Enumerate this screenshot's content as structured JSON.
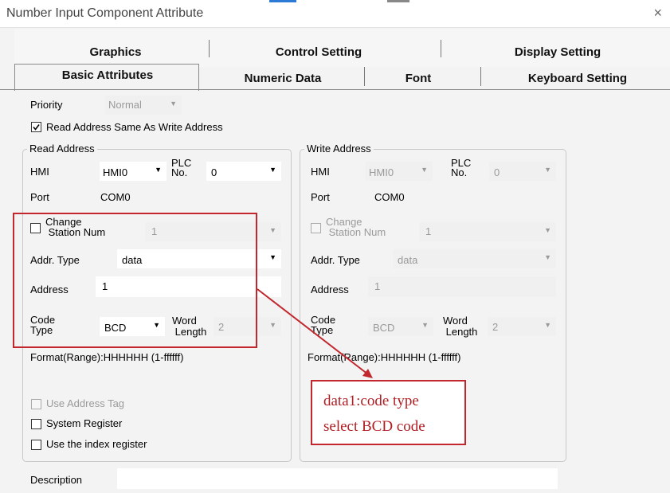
{
  "window": {
    "title": "Number Input Component Attribute",
    "close": "×"
  },
  "tabs": {
    "row1": [
      "Graphics",
      "Control Setting",
      "Display Setting"
    ],
    "row2": [
      "Basic Attributes",
      "Numeric Data",
      "Font",
      "Keyboard Setting"
    ]
  },
  "priority": {
    "label": "Priority",
    "value": "Normal"
  },
  "same_address": {
    "label": "Read Address Same As Write Address",
    "checked": true
  },
  "read": {
    "legend": "Read Address",
    "hmi_label": "HMI",
    "hmi_value": "HMI0",
    "plc_label_1": "PLC",
    "plc_label_2": "No.",
    "plc_value": "0",
    "port_label": "Port",
    "port_value": "COM0",
    "change_label_1": "Change",
    "change_label_2": "Station Num",
    "station_value": "1",
    "addr_type_label": "Addr. Type",
    "addr_type_value": "data",
    "address_label": "Address",
    "address_value": "1",
    "code_label_1": "Code",
    "code_label_2": "Type",
    "code_value": "BCD",
    "word_label_1": "Word",
    "word_label_2": "Length",
    "word_value": "2",
    "format": "Format(Range):HHHHHH (1-ffffff)"
  },
  "write": {
    "legend": "Write Address",
    "hmi_label": "HMI",
    "hmi_value": "HMI0",
    "plc_label_1": "PLC",
    "plc_label_2": "No.",
    "plc_value": "0",
    "port_label": "Port",
    "port_value": "COM0",
    "change_label_1": "Change",
    "change_label_2": "Station Num",
    "station_value": "1",
    "addr_type_label": "Addr. Type",
    "addr_type_value": "data",
    "address_label": "Address",
    "address_value": "1",
    "code_label_1": "Code",
    "code_label_2": "Type",
    "code_value": "BCD",
    "word_label_1": "Word",
    "word_label_2": "Length",
    "word_value": "2",
    "format": "Format(Range):HHHHHH (1-ffffff)"
  },
  "options": {
    "use_tag": "Use Address Tag",
    "system_register": "System Register",
    "index_register": "Use the index register"
  },
  "description": {
    "label": "Description",
    "value": ""
  },
  "callout": {
    "line1": "data1:code type",
    "line2": "select BCD code"
  },
  "colors": {
    "annotation_red": "#c1272d",
    "accent_blue": "#2b7bd6"
  }
}
